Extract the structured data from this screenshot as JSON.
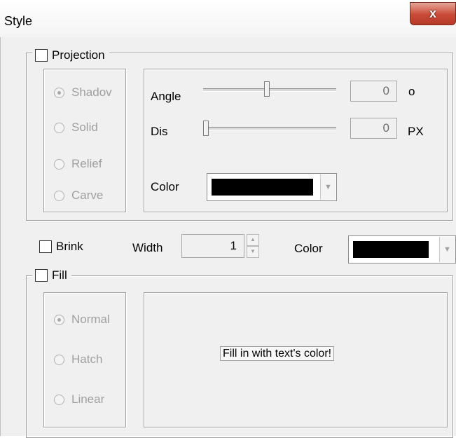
{
  "window": {
    "title": "Style",
    "close_glyph": "x"
  },
  "projection": {
    "label": "Projection",
    "options": [
      "Shadov",
      "Solid",
      "Relief",
      "Carve"
    ],
    "selected": "Shadov",
    "angle": {
      "label": "Angle",
      "value": "0",
      "unit": "o",
      "slider_fraction": 0.48
    },
    "dis": {
      "label": "Dis",
      "value": "0",
      "unit": "PX",
      "slider_fraction": 0.0
    },
    "color": {
      "label": "Color",
      "value_color": "#000000"
    }
  },
  "brink": {
    "label": "Brink",
    "width_label": "Width",
    "width_value": "1",
    "color_label": "Color",
    "value_color": "#000000"
  },
  "fill": {
    "label": "Fill",
    "options": [
      "Normal",
      "Hatch",
      "Linear"
    ],
    "selected": "Normal",
    "message": "Fill in with text's color!"
  }
}
